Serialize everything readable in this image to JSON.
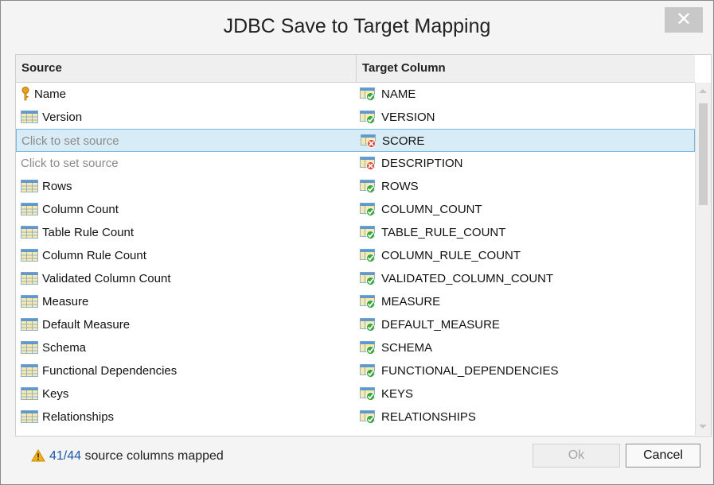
{
  "dialog": {
    "title": "JDBC Save to Target Mapping",
    "close_label": "✕"
  },
  "table": {
    "columns": [
      "Source",
      "Target Column"
    ],
    "rows": [
      {
        "source": "Name",
        "source_icon": "key-icon",
        "target": "NAME",
        "status": "ok"
      },
      {
        "source": "Version",
        "source_icon": "table-icon",
        "target": "VERSION",
        "status": "ok"
      },
      {
        "source": "Click to set source",
        "source_icon": "",
        "target": "SCORE",
        "status": "error",
        "placeholder": true,
        "selected": true
      },
      {
        "source": "Click to set source",
        "source_icon": "",
        "target": "DESCRIPTION",
        "status": "error",
        "placeholder": true
      },
      {
        "source": "Rows",
        "source_icon": "table-icon",
        "target": "ROWS",
        "status": "ok"
      },
      {
        "source": "Column Count",
        "source_icon": "table-icon",
        "target": "COLUMN_COUNT",
        "status": "ok"
      },
      {
        "source": "Table Rule Count",
        "source_icon": "table-icon",
        "target": "TABLE_RULE_COUNT",
        "status": "ok"
      },
      {
        "source": "Column Rule Count",
        "source_icon": "table-icon",
        "target": "COLUMN_RULE_COUNT",
        "status": "ok"
      },
      {
        "source": "Validated Column Count",
        "source_icon": "table-icon",
        "target": "VALIDATED_COLUMN_COUNT",
        "status": "ok"
      },
      {
        "source": "Measure",
        "source_icon": "table-icon",
        "target": "MEASURE",
        "status": "ok"
      },
      {
        "source": "Default Measure",
        "source_icon": "table-icon",
        "target": "DEFAULT_MEASURE",
        "status": "ok"
      },
      {
        "source": "Schema",
        "source_icon": "table-icon",
        "target": "SCHEMA",
        "status": "ok"
      },
      {
        "source": "Functional Dependencies",
        "source_icon": "table-icon",
        "target": "FUNCTIONAL_DEPENDENCIES",
        "status": "ok"
      },
      {
        "source": "Keys",
        "source_icon": "table-icon",
        "target": "KEYS",
        "status": "ok"
      },
      {
        "source": "Relationships",
        "source_icon": "table-icon",
        "target": "RELATIONSHIPS",
        "status": "ok"
      }
    ]
  },
  "footer": {
    "status_icon": "warning-icon",
    "mapped_count": "41/44",
    "status_text": " source columns mapped",
    "ok_label": "Ok",
    "cancel_label": "Cancel"
  },
  "colors": {
    "selection_bg": "#d8ecf8",
    "selection_border": "#7ab8e2",
    "ok_badge": "#3aa53a",
    "error_badge": "#e04a3a",
    "warning": "#f2b01e",
    "link_count": "#1a5aa8"
  }
}
